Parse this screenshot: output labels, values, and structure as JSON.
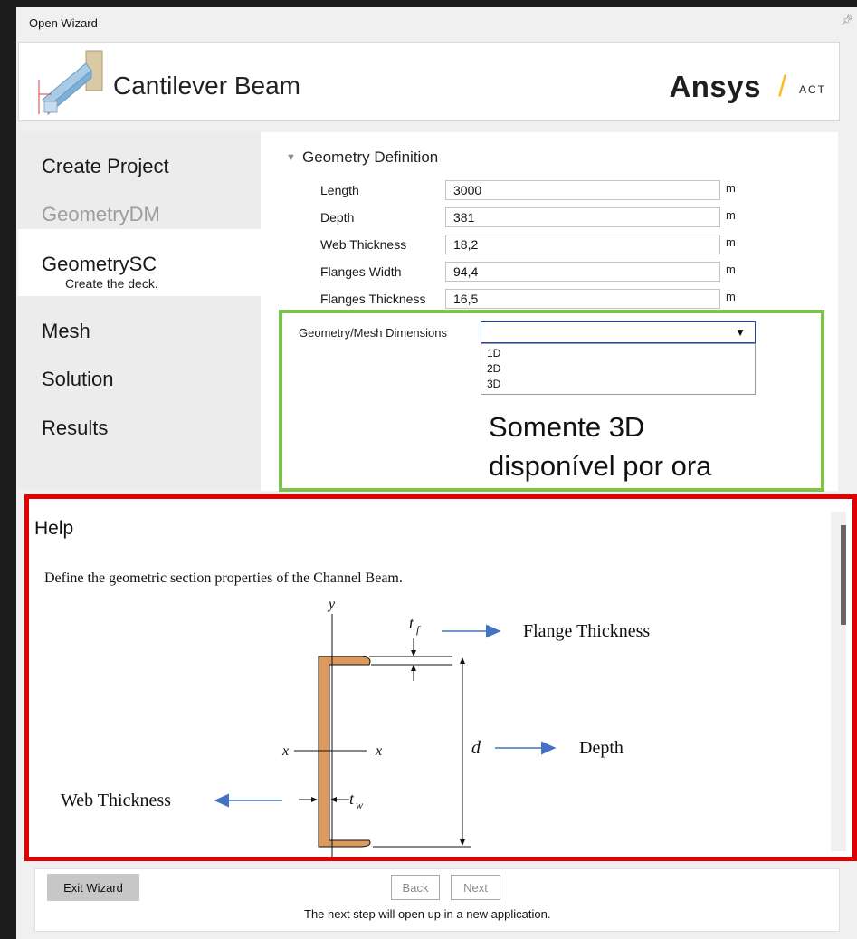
{
  "window": {
    "title": "Open Wizard"
  },
  "header": {
    "title": "Cantilever Beam",
    "brand": "Ansys",
    "brand_slash": "/",
    "brand_suffix": "ACT"
  },
  "sidebar": {
    "items": [
      {
        "label": "Create Project",
        "state": "default"
      },
      {
        "label": "GeometryDM",
        "state": "disabled"
      },
      {
        "label": "GeometrySC",
        "sublabel": "Create the deck.",
        "state": "active"
      },
      {
        "label": "Mesh",
        "state": "default"
      },
      {
        "label": "Solution",
        "state": "default"
      },
      {
        "label": "Results",
        "state": "default"
      }
    ]
  },
  "geometry": {
    "section_title": "Geometry Definition",
    "fields": [
      {
        "label": "Length",
        "value": "3000",
        "unit": "m"
      },
      {
        "label": "Depth",
        "value": "381",
        "unit": "m"
      },
      {
        "label": "Web Thickness",
        "value": "18,2",
        "unit": "m"
      },
      {
        "label": "Flanges Width",
        "value": "94,4",
        "unit": "m"
      },
      {
        "label": "Flanges Thickness",
        "value": "16,5",
        "unit": "m"
      }
    ],
    "dimensions": {
      "label": "Geometry/Mesh Dimensions",
      "value": "",
      "options": [
        "1D",
        "2D",
        "3D"
      ]
    }
  },
  "annotation": {
    "line1": "Somente 3D",
    "line2": "disponível por ora"
  },
  "help": {
    "title": "Help",
    "description": "Define the geometric section properties of the Channel Beam.",
    "diagram": {
      "axis_y": "y",
      "axis_x_left": "x",
      "axis_x_right": "x",
      "tf_symbol": "t",
      "tf_sub": "f",
      "tw_symbol": "t",
      "tw_sub": "w",
      "d_symbol": "d",
      "flange_label": "Flange Thickness",
      "depth_label": "Depth",
      "web_label": "Web Thickness"
    }
  },
  "footer": {
    "exit_label": "Exit Wizard",
    "back_label": "Back",
    "next_label": "Next",
    "note": "The next step will open up in a new application."
  },
  "colors": {
    "highlight_green": "#7cc44a",
    "highlight_red": "#e10000",
    "beam_fill": "#dd9a5e",
    "arrow_blue": "#4472c4",
    "brand_accent": "#ffb71b"
  }
}
